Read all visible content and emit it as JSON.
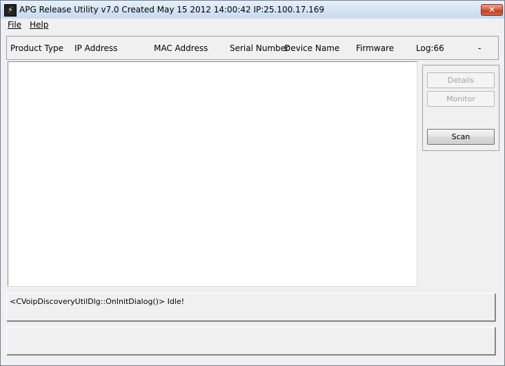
{
  "window": {
    "title": "APG Release Utility v7.0 Created May 15 2012 14:00:42   IP:25.100.17.169",
    "icon": "app-icon",
    "close_glyph": "✕"
  },
  "menu": {
    "file_label": "File",
    "help_label": "Help"
  },
  "columns": [
    "Product Type",
    "IP Address",
    "MAC Address",
    "Serial Number",
    "Device Name",
    "Firmware",
    "Log:66",
    "-"
  ],
  "buttons": {
    "details": "Details",
    "monitor": "Monitor",
    "scan": "Scan"
  },
  "status": {
    "line1": "<CVoipDiscoveryUtilDlg::OnInitDialog()> Idle!",
    "line2": ""
  }
}
